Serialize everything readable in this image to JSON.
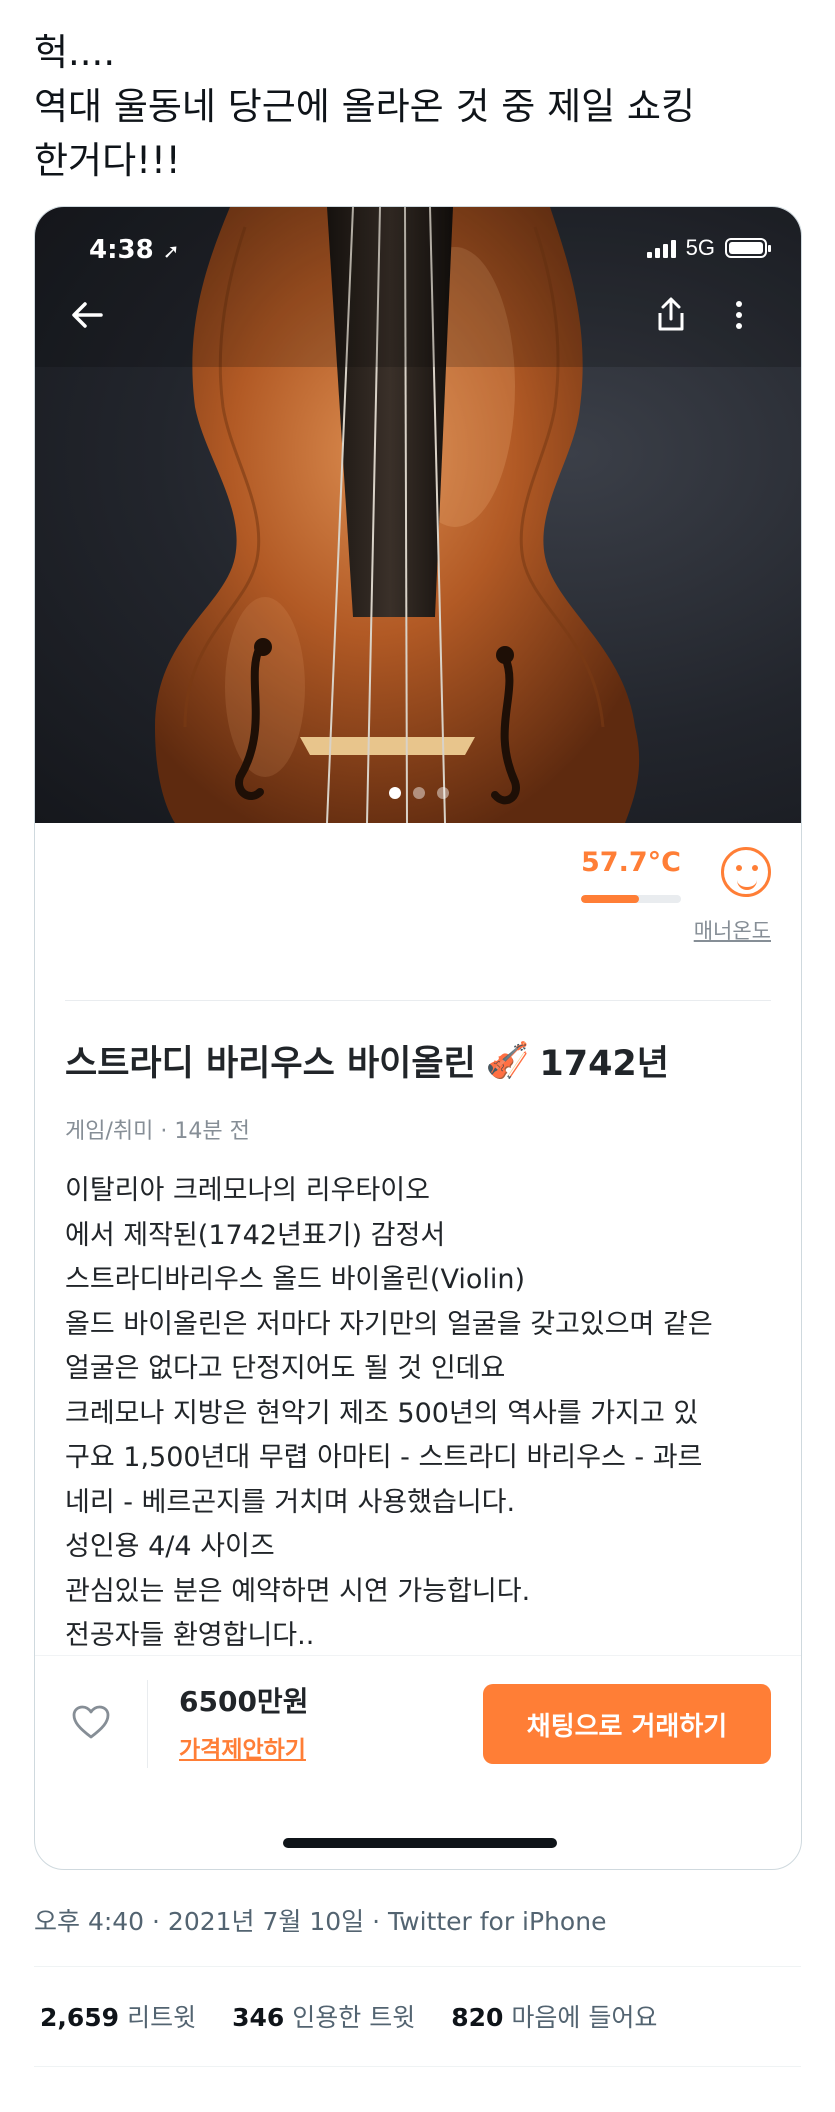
{
  "tweet": {
    "text": "헉....\n역대 울동네 당근에 올라온 것 중 제일 쇼킹\n한거다!!!",
    "meta": "오후 4:40 · 2021년 7월 10일 · Twitter for iPhone",
    "stats": {
      "retweets_count": "2,659",
      "retweets_label": "리트윗",
      "quotes_count": "346",
      "quotes_label": "인용한 트윗",
      "likes_count": "820",
      "likes_label": "마음에 들어요"
    }
  },
  "phone": {
    "status_time": "4:38",
    "network": "5G"
  },
  "listing": {
    "photo_page": 1,
    "photo_total": 3,
    "temperature": "57.7°C",
    "temperature_level": 0.577,
    "temperature_label": "매너온도",
    "title": "스트라디 바리우스 바이올린",
    "title_emoji": "🎻",
    "title_year": "1742년",
    "meta": "게임/취미 · 14분 전",
    "description": "이탈리아 크레모나의 리우타이오\n에서 제작된(1742년표기) 감정서\n스트라디바리우스 올드 바이올린(Violin)\n올드 바이올린은 저마다 자기만의 얼굴을 갖고있으며 같은\n얼굴은 없다고 단정지어도 될 것 인데요\n 크레모나 지방은 현악기 제조 500년의 역사를 가지고 있\n구요 1,500년대 무렵  아마티 - 스트라디 바리우스 - 과르\n네리 - 베르곤지를 거치며  사용했습니다.\n성인용 4/4 사이즈\n관심있는 분은 예약하면 시연 가능합니다.\n전공자들 환영합니다..",
    "price": "6500만원",
    "offer_label": "가격제안하기",
    "chat_button_label": "채팅으로 거래하기",
    "accent_color": "#ff7e36"
  },
  "icons": {
    "back": "arrow-left-icon",
    "share": "share-icon",
    "more": "more-vertical-icon",
    "heart": "heart-outline-icon",
    "location": "location-arrow-icon"
  }
}
